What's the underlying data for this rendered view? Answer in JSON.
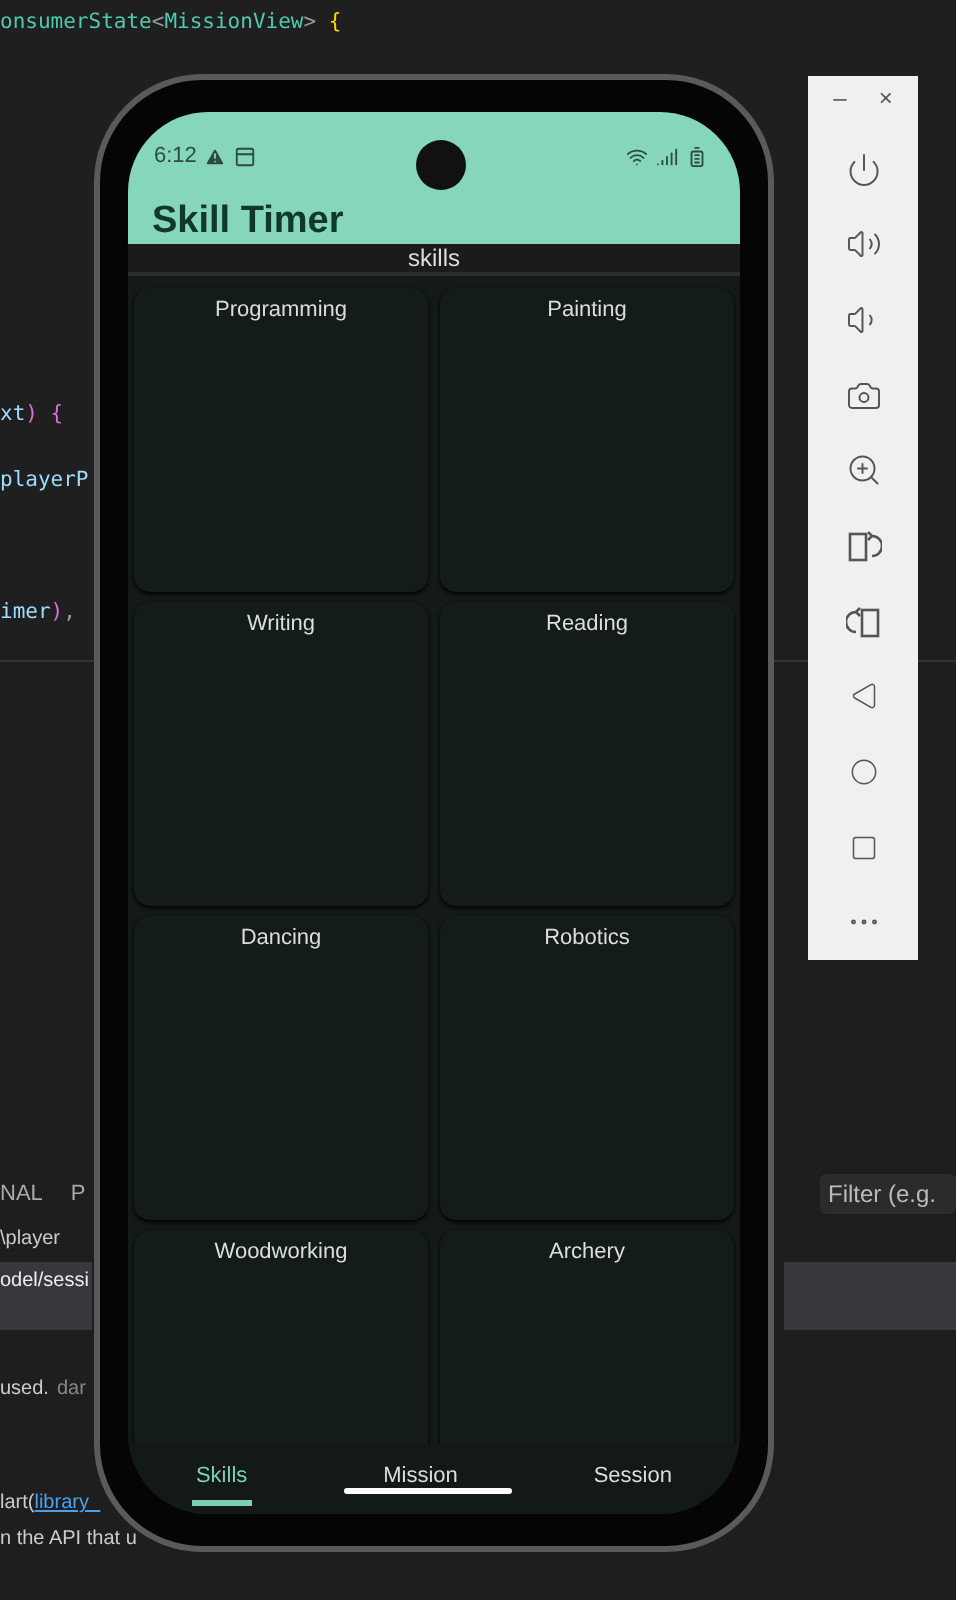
{
  "editor": {
    "lines": [
      {
        "tokens": [
          {
            "kind": "type",
            "text": "onsumerState"
          },
          {
            "kind": "punct",
            "text": "<"
          },
          {
            "kind": "type",
            "text": "MissionView"
          },
          {
            "kind": "punct",
            "text": ">"
          },
          {
            "kind": "brace",
            "text": "{"
          }
        ]
      },
      {
        "tokens": [
          {
            "kind": "var",
            "text": "xt"
          },
          {
            "kind": "paren",
            "text": ")"
          },
          {
            "kind": "paren",
            "text": "{"
          }
        ]
      },
      {
        "tokens": [
          {
            "kind": "var",
            "text": "playerP"
          }
        ]
      },
      {
        "tokens": [
          {
            "kind": "var",
            "text": "imer"
          },
          {
            "kind": "paren",
            "text": ")"
          },
          {
            "kind": "punct",
            "text": ","
          }
        ]
      }
    ]
  },
  "panel": {
    "tabs": [
      "NAL",
      "P"
    ],
    "filter": {
      "placeholder": "Filter (e.g."
    },
    "path": "\\player",
    "selected_row": "odel/sessi",
    "message": {
      "text": "used.",
      "source": "dar"
    },
    "link_line": {
      "prefix": "lart(",
      "link": "library_"
    },
    "note": "n the API that u"
  },
  "emulator": {
    "status": {
      "time": "6:12"
    },
    "app_title": "Skill Timer",
    "header": "skills",
    "skills": [
      "Programming",
      "Painting",
      "Writing",
      "Reading",
      "Dancing",
      "Robotics",
      "Woodworking",
      "Archery"
    ],
    "nav": [
      {
        "label": "Skills",
        "selected": true
      },
      {
        "label": "Mission",
        "selected": false
      },
      {
        "label": "Session",
        "selected": false
      }
    ]
  },
  "toolbar": {
    "window_buttons": [
      "–",
      "×"
    ]
  }
}
